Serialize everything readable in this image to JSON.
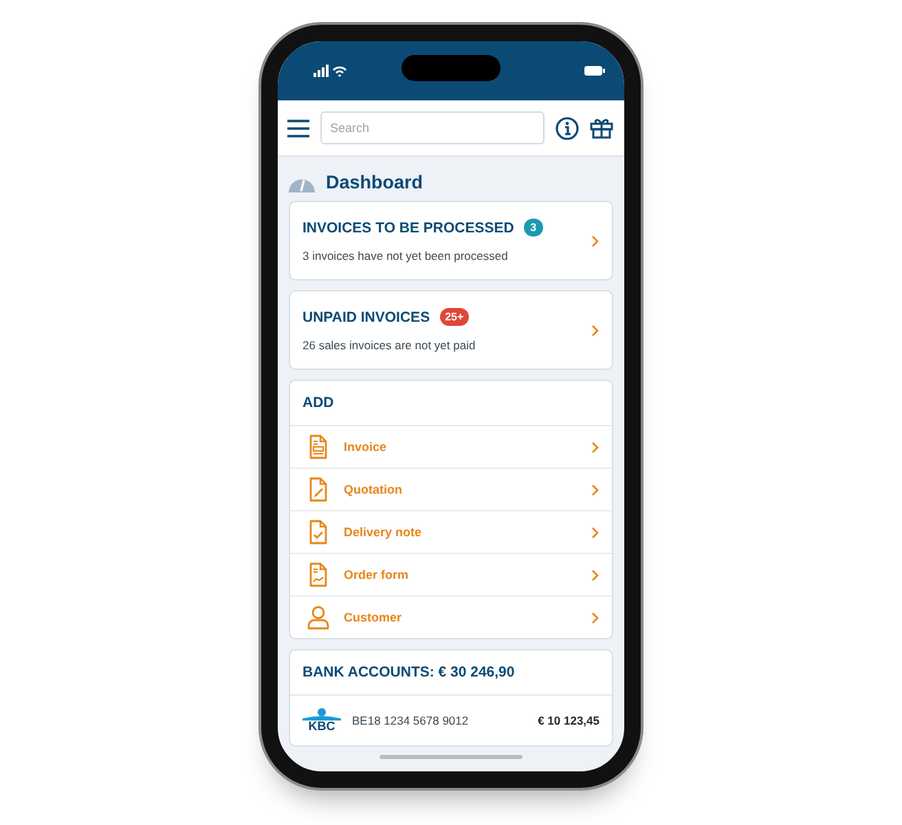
{
  "header": {
    "search": {
      "placeholder": "Search"
    }
  },
  "page_title": "Dashboard",
  "summary_cards": [
    {
      "title": "INVOICES TO BE PROCESSED",
      "badge": "3",
      "color": "#1a9bb0",
      "subtitle": "3 invoices have not yet been processed"
    },
    {
      "title": "UNPAID INVOICES",
      "badge": "25+",
      "color": "#e0463a",
      "subtitle": "26 sales invoices are not yet paid"
    }
  ],
  "add": {
    "title": "ADD",
    "items": [
      {
        "kind": "invoice",
        "label": "Invoice"
      },
      {
        "kind": "quotation",
        "label": "Quotation"
      },
      {
        "kind": "delivery",
        "label": "Delivery note"
      },
      {
        "kind": "order",
        "label": "Order form"
      },
      {
        "kind": "customer",
        "label": "Customer"
      }
    ]
  },
  "bank": {
    "title": "BANK ACCOUNTS: € 30 246,90",
    "accounts": [
      {
        "logo": "KBC",
        "iban": "BE18 1234 5678 9012",
        "amount": "€ 10 123,45"
      }
    ]
  }
}
